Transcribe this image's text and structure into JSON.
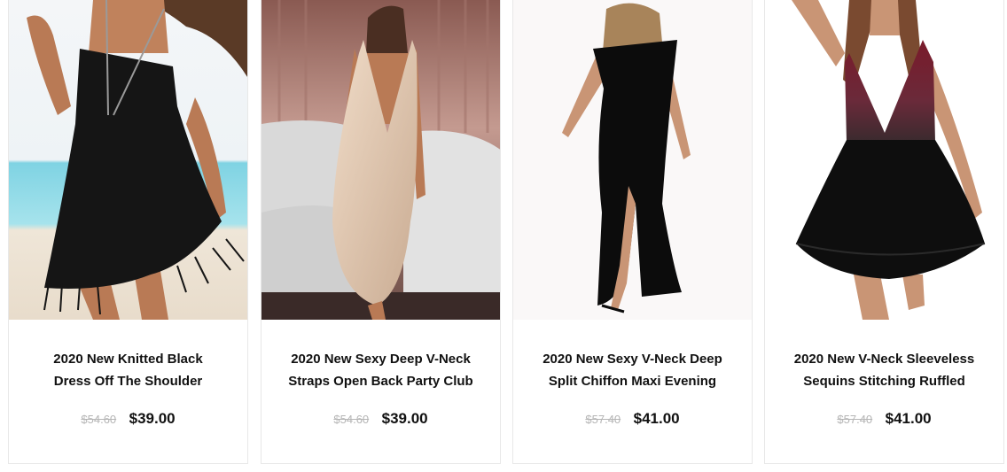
{
  "products": [
    {
      "image": "woman-black-strapless-fringe-dress-photo",
      "title_line1": "2020 New Knitted Black",
      "title_line2": "Dress Off The Shoulder",
      "old_price": "$54.60",
      "price": "$39.00"
    },
    {
      "image": "woman-gold-glitter-bodycon-dress-photo",
      "title_line1": "2020 New Sexy Deep V-Neck",
      "title_line2": "Straps Open Back Party Club",
      "old_price": "$54.60",
      "price": "$39.00"
    },
    {
      "image": "woman-black-slit-maxi-dress-photo",
      "title_line1": "2020 New Sexy V-Neck Deep",
      "title_line2": "Split Chiffon Maxi Evening",
      "old_price": "$57.40",
      "price": "$41.00"
    },
    {
      "image": "woman-burgundy-sequin-black-skater-dress-photo",
      "title_line1": "2020 New V-Neck Sleeveless",
      "title_line2": "Sequins Stitching Ruffled",
      "old_price": "$57.40",
      "price": "$41.00"
    }
  ],
  "colors": {
    "price": "#111111",
    "old_price": "#b5b5b5",
    "card_border": "#e8e8e8"
  }
}
